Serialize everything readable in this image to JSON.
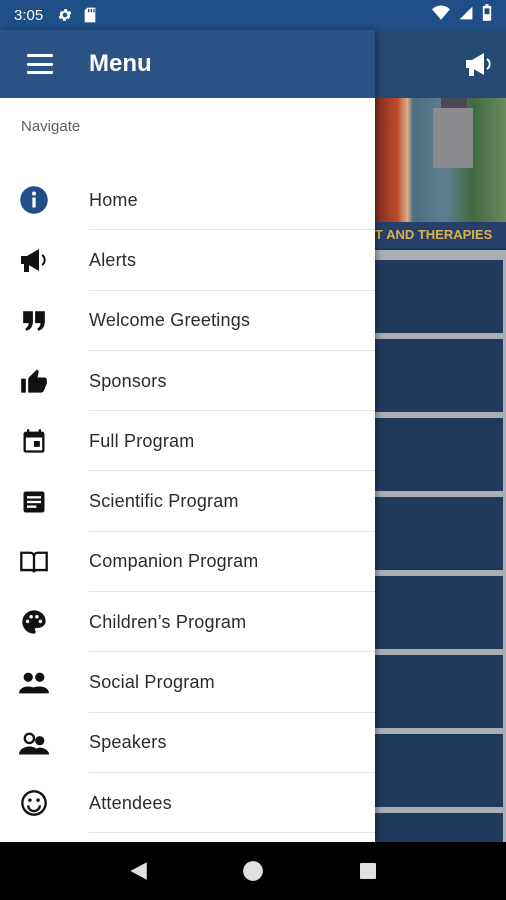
{
  "status_bar": {
    "time": "3:05",
    "icons_left": [
      "gear-icon",
      "sd-card-icon"
    ],
    "icons_right": [
      "wifi-icon",
      "signal-icon",
      "battery-icon"
    ]
  },
  "app": {
    "banner_text": "T AND THERAPIES",
    "toolbar_icon": "megaphone-icon",
    "tile_count": 8,
    "colors": {
      "toolbar": "#244a73",
      "tile": "#203a5e",
      "banner_text": "#d9b24a"
    }
  },
  "drawer": {
    "title": "Menu",
    "section_label": "Navigate",
    "colors": {
      "header": "#2b5385",
      "primary_icon": "#1f4f86"
    },
    "items": [
      {
        "label": "Home",
        "icon": "info-icon"
      },
      {
        "label": "Alerts",
        "icon": "megaphone-icon"
      },
      {
        "label": "Welcome Greetings",
        "icon": "quote-icon"
      },
      {
        "label": "Sponsors",
        "icon": "thumbs-up-icon"
      },
      {
        "label": "Full Program",
        "icon": "calendar-icon"
      },
      {
        "label": "Scientific Program",
        "icon": "document-icon"
      },
      {
        "label": "Companion Program",
        "icon": "book-icon"
      },
      {
        "label": "Children’s Program",
        "icon": "palette-icon"
      },
      {
        "label": "Social Program",
        "icon": "people-icon"
      },
      {
        "label": "Speakers",
        "icon": "speakers-icon"
      },
      {
        "label": "Attendees",
        "icon": "smiley-icon"
      }
    ]
  },
  "nav_bar": {
    "buttons": [
      "back-icon",
      "home-icon",
      "recents-icon"
    ]
  }
}
